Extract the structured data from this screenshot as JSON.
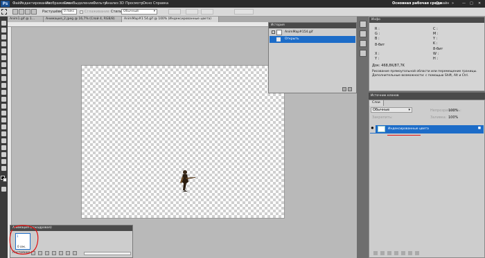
{
  "app": {
    "logo": "Ps"
  },
  "menu": [
    "Файл",
    "Редактирование",
    "Изображение",
    "Слои",
    "Выделение",
    "Фильтр",
    "Анализ",
    "3D",
    "Просмотр",
    "Окно",
    "Справка"
  ],
  "menubar_right": {
    "workspace": "Основная рабочая среда",
    "design": "Дизайн"
  },
  "options": {
    "feather_label": "Растушёвка:",
    "feather_value": "0 пикс",
    "smooth_label": "Сглаживание",
    "style_label": "Стиль:",
    "style_value": "Обычный"
  },
  "tabs": [
    {
      "label": "Anim1.gif @ 1..."
    },
    {
      "label": "Анимация_2.jpeg @ 16,7% (Слой 4, RGB/8)"
    },
    {
      "label": "AnimMap#1 54.gif @ 100% (Индексированные цвета)"
    }
  ],
  "history": {
    "title": "История",
    "doc": "AnimMap#154.gif",
    "step": "Открыть"
  },
  "info": {
    "title": "Инфо",
    "r": "R :",
    "g": "G :",
    "b": "B :",
    "c": "C :",
    "m": "M :",
    "y": "Y :",
    "k": "K :",
    "bit_left": "8-бит",
    "bit_right": "8-бит",
    "x": "X :",
    "y2": "Y :",
    "w": "W :",
    "h": "H :",
    "doc": "Док: 468,8K/87,7K",
    "hint": "Рисование прямоугольной области или перемещение границы. Дополнительные возможности: с помощью Shift, Alt и Ctrl."
  },
  "source": {
    "title": "Источник клонов"
  },
  "layers": {
    "tab": "Слои",
    "blend": "Обычные",
    "opacity_label": "Непрозрачность:",
    "opacity": "100%",
    "lock_label": "Закрепить:",
    "fill_label": "Заливка:",
    "fill": "100%",
    "layer_name": "Индексированные цвета"
  },
  "animation": {
    "title": "Анимация (покадровая)",
    "frame_time": "0 сек.",
    "loop": "Постоянно"
  },
  "colors": {
    "accent": "#1c6cc8",
    "annotation": "#e01010"
  }
}
